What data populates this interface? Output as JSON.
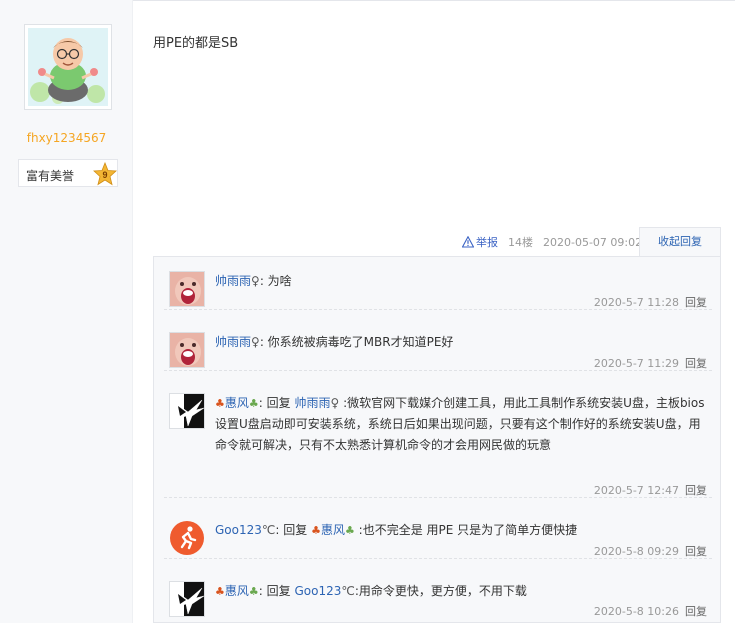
{
  "author": {
    "name": "fhxy1234567",
    "badge_label": "富有美誉",
    "badge_level": "9"
  },
  "post": {
    "content": "用PE的都是SB",
    "report_label": "举报",
    "floor": "14楼",
    "datetime": "2020-05-07 09:02",
    "collapse_label": "收起回复"
  },
  "replies": [
    {
      "user": "帅雨雨",
      "gender": "♀",
      "sep": ": ",
      "text": "为啥",
      "time": "2020-5-7 11:28",
      "reply_label": "回复"
    },
    {
      "user": "帅雨雨",
      "gender": "♀",
      "sep": ": ",
      "text": "你系统被病毒吃了MBR才知道PE好",
      "time": "2020-5-7 11:29",
      "reply_label": "回复"
    },
    {
      "user": "惠风",
      "sep": ": ",
      "reply_word": "回复",
      "target": "帅雨雨",
      "target_gender": "♀",
      "text": ":微软官网下载媒介创建工具，用此工具制作系统安装U盘，主板bios设置U盘启动即可安装系统，系统日后如果出现问题，只要有这个制作好的系统安装U盘，用命令就可解决，只有不太熟悉计算机命令的才会用网民做的玩意",
      "time": "2020-5-7 12:47",
      "reply_label": "回复"
    },
    {
      "user": "Goo123",
      "degree": "℃",
      "sep": ": ",
      "reply_word": "回复",
      "target": "惠风",
      "text": ":也不完全是 用PE 只是为了简单方便快捷",
      "time": "2020-5-8 09:29",
      "reply_label": "回复"
    },
    {
      "user": "惠风",
      "sep": ": ",
      "reply_word": "回复",
      "target": "Goo123",
      "target_degree": "℃",
      "text": ":用命令更快，更方便，不用下载",
      "time": "2020-5-8 10:26",
      "reply_label": "回复"
    }
  ],
  "icons": {
    "maple_leaf": "maple-leaf-icon",
    "green_leaf": "leaf-icon",
    "warning": "warning-icon",
    "badge_star": "star-badge-icon"
  },
  "colors": {
    "link": "#2d64b3",
    "author": "#f5a623",
    "meta": "#999999",
    "maple": "#d9541e",
    "leaf": "#6aa84f"
  }
}
